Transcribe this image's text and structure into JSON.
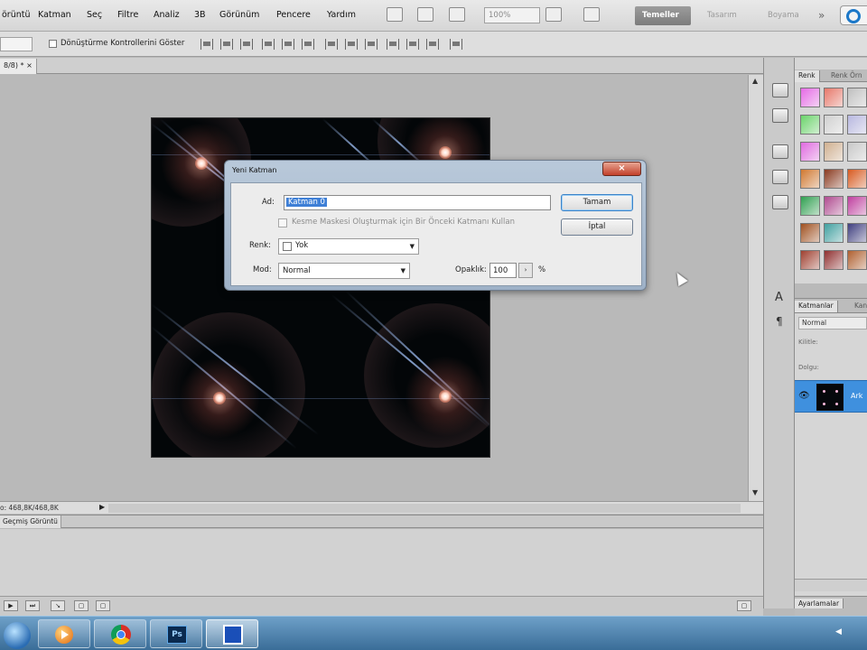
{
  "menu": {
    "items": [
      "örüntü",
      "Katman",
      "Seç",
      "Filtre",
      "Analiz",
      "3B",
      "Görünüm",
      "Pencere",
      "Yardım"
    ],
    "zoom": "100%",
    "workspaces": {
      "essentials": "Temeller",
      "design": "Tasarım",
      "painting": "Boyama",
      "more": "»"
    }
  },
  "options": {
    "transform_controls_label": "Dönüştürme Kontrollerini Göster"
  },
  "document": {
    "tab_label": "8/8) * ×",
    "status_text": "o: 468,8K/468,8K"
  },
  "dialog": {
    "title": "Yeni Katman",
    "close_label": "×",
    "name_label": "Ad:",
    "name_value": "Katman 0",
    "mask_label": "Kesme Maskesi Oluşturmak için Bir Önceki Katmanı Kullan",
    "color_label": "Renk:",
    "color_value": "Yok",
    "mode_label": "Mod:",
    "mode_value": "Normal",
    "opacity_label": "Opaklık:",
    "opacity_value": "100",
    "opacity_unit": "%",
    "ok_label": "Tamam",
    "cancel_label": "İptal"
  },
  "panels": {
    "styles_tab_color": "Renk",
    "styles_tab_swatches": "Renk Örn",
    "layers_tab": "Katmanlar",
    "channels_tab": "Kan",
    "blend_mode": "Normal",
    "lock_label": "Kilitle:",
    "fill_label": "Dolgu:",
    "layer_name": "Ark",
    "adjustments_tab": "Ayarlamalar"
  },
  "history": {
    "tab_label": "Geçmiş Görüntü"
  },
  "swatches": {
    "colors": [
      "#e66ae6",
      "#e8786a",
      "#c0c0c0",
      "#6ad46a",
      "#d0d0d0",
      "#b8b8e0",
      "#e06ae0",
      "#d0b090",
      "#c8c8c8",
      "#d07830",
      "#8a3a20",
      "#d85a20",
      "#30a050",
      "#b04a90",
      "#c040a0",
      "#a05020",
      "#40a0a0",
      "#404080",
      "#a04030",
      "#903030",
      "#b06030"
    ]
  }
}
